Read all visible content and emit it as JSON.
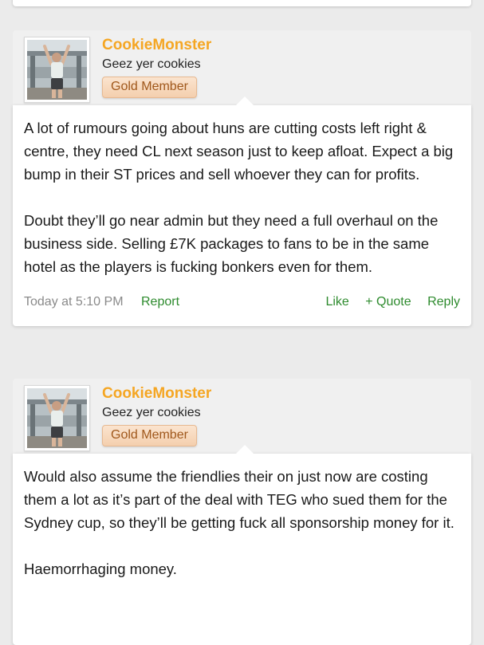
{
  "posts": [
    {
      "username": "CookieMonster",
      "user_title": "Geez yer cookies",
      "badge": "Gold Member",
      "paragraphs": [
        "A lot of rumours going about huns are cutting costs left right & centre, they need CL next season just to keep afloat. Expect a big bump in their ST prices and sell whoever they can for profits.",
        "Doubt they’ll go near admin but they need a full overhaul on the business side. Selling £7K packages to fans to be in the same hotel as the players is fucking bonkers even for them."
      ],
      "time": "Today at 5:10 PM",
      "report": "Report",
      "like": "Like",
      "quote": "+ Quote",
      "reply": "Reply"
    },
    {
      "username": "CookieMonster",
      "user_title": "Geez yer cookies",
      "badge": "Gold Member",
      "paragraphs": [
        "Would also assume the friendlies their on just now are costing them a lot as it’s part of the deal with TEG who sued them for the Sydney cup, so they’ll be getting fuck all sponsorship money for it.",
        "Haemorrhaging money."
      ]
    }
  ],
  "colors": {
    "username": "#f5a623",
    "badge_text": "#a0581c",
    "link": "#2e8b2e",
    "timestamp": "#8a8a8a",
    "page_background": "#ebebeb"
  }
}
